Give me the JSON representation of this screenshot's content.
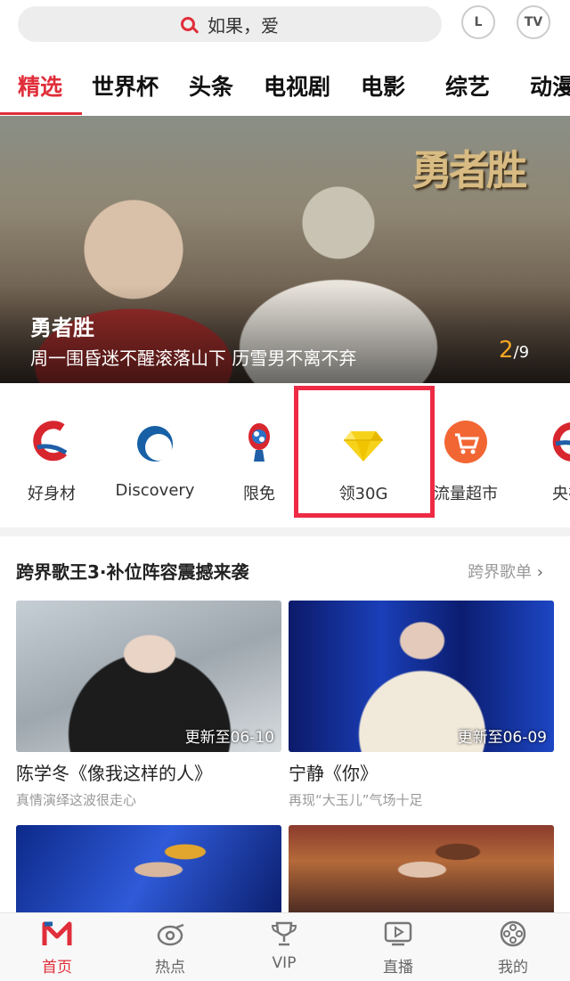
{
  "search": {
    "text": "如果，爱"
  },
  "header_buttons": {
    "left_btn": "L",
    "tv_btn": "TV"
  },
  "tabs": [
    "精选",
    "世界杯",
    "头条",
    "电视剧",
    "电影",
    "综艺",
    "动漫"
  ],
  "banner": {
    "logo_text": "勇者胜",
    "title": "勇者胜",
    "subtitle": "周一围昏迷不醒滚落山下 历雪男不离不弃",
    "page_current": "2",
    "page_total": "/9"
  },
  "quick_entries": [
    {
      "label": "好身材",
      "icon": "good-figure-icon"
    },
    {
      "label": "Discovery",
      "icon": "discovery-icon"
    },
    {
      "label": "限免",
      "icon": "free-limited-icon"
    },
    {
      "label": "领30G",
      "icon": "diamond-icon"
    },
    {
      "label": "流量超市",
      "icon": "shopping-cart-icon"
    },
    {
      "label": "央视",
      "icon": "cctv-icon"
    }
  ],
  "section": {
    "title": "跨界歌王3·补位阵容震撼来袭",
    "more": "跨界歌单"
  },
  "cards": [
    {
      "badge": "更新至06-10",
      "title": "陈学冬《像我这样的人》",
      "desc": "真情演绎这波很走心"
    },
    {
      "badge": "更新至06-09",
      "title": "宁静《你》",
      "desc": "再现“大玉儿”气场十足"
    }
  ],
  "bottom_nav": [
    {
      "label": "首页",
      "icon": "home-logo-icon"
    },
    {
      "label": "热点",
      "icon": "whistle-icon"
    },
    {
      "label": "VIP",
      "icon": "trophy-icon"
    },
    {
      "label": "直播",
      "icon": "tv-play-icon"
    },
    {
      "label": "我的",
      "icon": "film-reel-icon"
    }
  ],
  "colors": {
    "accent": "#e02e3a",
    "highlight_box": "#ee2a45"
  }
}
